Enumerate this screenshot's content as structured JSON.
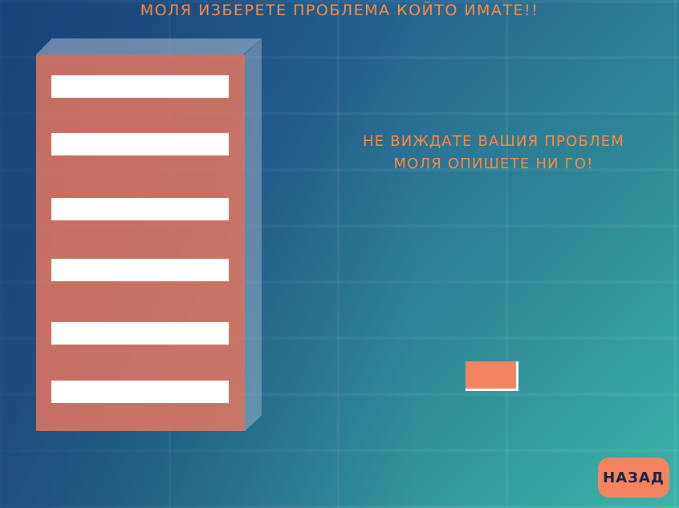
{
  "header": {
    "title": "МОЛЯ ИЗБЕРЕТЕ ПРОБЛЕМА КОЙТО ИМАТЕ!!"
  },
  "options_panel": {
    "items": [
      {
        "label": ""
      },
      {
        "label": ""
      },
      {
        "label": ""
      },
      {
        "label": ""
      },
      {
        "label": ""
      },
      {
        "label": ""
      }
    ]
  },
  "notice": {
    "line1": "НЕ ВИЖДАТЕ ВАШИЯ ПРОБЛЕМ",
    "line2": "МОЛЯ ОПИШЕТЕ НИ ГО!"
  },
  "footer": {
    "back_label": "НАЗАД"
  },
  "colors": {
    "accent": "#ff8a3d",
    "panel": "#eb785f",
    "button": "#f4845f",
    "background_start": "#1b4f86",
    "background_end": "#3bb3a7"
  }
}
